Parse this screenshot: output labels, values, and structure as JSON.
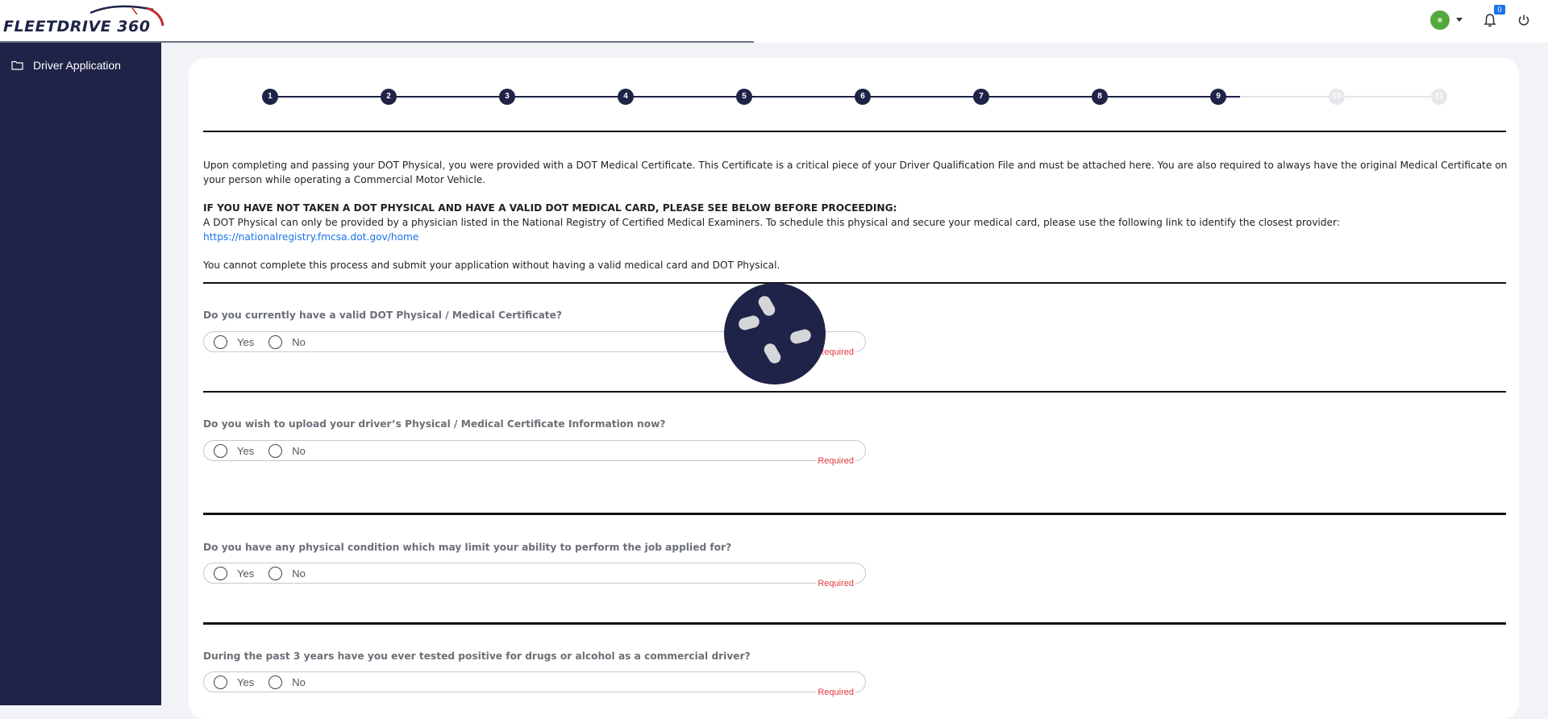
{
  "header": {
    "logo_text": "FLEETDRIVE 360",
    "notification_count": "0"
  },
  "sidebar": {
    "items": [
      {
        "label": "Driver Application",
        "icon": "folder-icon"
      }
    ]
  },
  "stepper": {
    "steps": [
      "1",
      "2",
      "3",
      "4",
      "5",
      "6",
      "7",
      "8",
      "9",
      "10",
      "11"
    ],
    "current": 9
  },
  "intro": {
    "p1": "Upon completing and passing your DOT Physical, you were provided with a DOT Medical Certificate. This Certificate is a critical piece of your Driver Qualification File and must be attached here. You are also required to always have the original Medical Certificate on your person while operating a Commercial Motor Vehicle.",
    "warning_heading": "IF YOU HAVE NOT TAKEN A DOT PHYSICAL AND HAVE A VALID DOT MEDICAL CARD, PLEASE SEE BELOW BEFORE PROCEEDING:",
    "p2": "A DOT Physical can only be provided by a physician listed in the National Registry of Certified Medical Examiners. To schedule this physical and secure your medical card, please use the following link to identify the closest provider: ",
    "link": "https://nationalregistry.fmcsa.dot.gov/home",
    "p3": "You cannot complete this process and submit your application without having a valid medical card and DOT Physical."
  },
  "questions": [
    {
      "text": "Do you currently have a valid DOT Physical / Medical Certificate?",
      "yes": "Yes",
      "no": "No",
      "required": "Required"
    },
    {
      "text": "Do you wish to upload your driver’s Physical / Medical Certificate Information now?",
      "yes": "Yes",
      "no": "No",
      "required": "Required"
    },
    {
      "text": "Do you have any physical condition which may limit your ability to perform the job applied for?",
      "yes": "Yes",
      "no": "No",
      "required": "Required"
    },
    {
      "text": "During the past 3 years have you ever tested positive for drugs or alcohol as a commercial driver?",
      "yes": "Yes",
      "no": "No",
      "required": "Required"
    }
  ],
  "colors": {
    "sidebar": "#1f2347",
    "accent": "#1a73e8",
    "required": "#e0393e",
    "avatar": "#55a83a"
  }
}
